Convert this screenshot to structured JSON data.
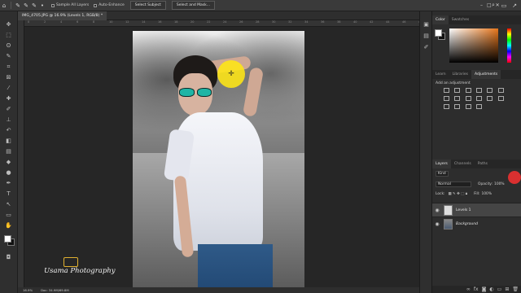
{
  "options_bar": {
    "sample_all_layers": "Sample All Layers",
    "auto_enhance": "Auto-Enhance",
    "select_subject": "Select Subject",
    "select_and_mask": "Select and Mask..."
  },
  "document": {
    "tab_title": "IMG_4705.JPG @ 16.9% (Levels 1, RGB/8) *",
    "zoom": "16.9%",
    "doc_size": "Doc: 34.9M/69.8M"
  },
  "ruler_ticks": [
    "0",
    "2",
    "4",
    "6",
    "8",
    "10",
    "12",
    "14",
    "16",
    "18",
    "20",
    "22",
    "24",
    "26",
    "28",
    "30",
    "32",
    "34",
    "36",
    "38",
    "40",
    "42",
    "44",
    "46",
    "48"
  ],
  "watermark": {
    "text": "Usama Photography"
  },
  "color_panel": {
    "tabs": [
      "Color",
      "Swatches"
    ],
    "active_tab": "Color",
    "accent_color": "#e8771c"
  },
  "adjustments_panel": {
    "tabs": [
      "Learn",
      "Libraries",
      "Adjustments"
    ],
    "active_tab": "Adjustments",
    "add_label": "Add an adjustment"
  },
  "layers_panel": {
    "tabs": [
      "Layers",
      "Channels",
      "Paths"
    ],
    "active_tab": "Layers",
    "kind_filter": "Kind",
    "blend_mode": "Normal",
    "opacity_label": "Opacity:",
    "opacity_value": "100%",
    "lock_label": "Lock:",
    "fill_label": "Fill:",
    "fill_value": "100%",
    "layers": [
      {
        "name": "Levels 1",
        "selected": true
      },
      {
        "name": "Background",
        "selected": false
      }
    ]
  }
}
